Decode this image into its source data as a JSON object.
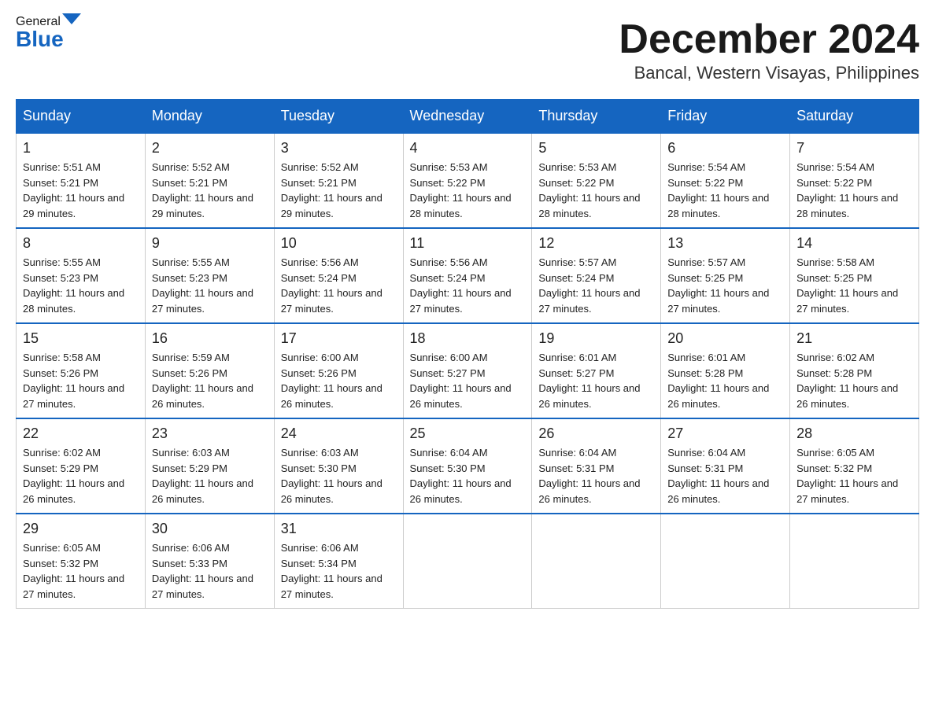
{
  "header": {
    "logo_general": "General",
    "logo_blue": "Blue",
    "month_title": "December 2024",
    "location": "Bancal, Western Visayas, Philippines"
  },
  "days_of_week": [
    "Sunday",
    "Monday",
    "Tuesday",
    "Wednesday",
    "Thursday",
    "Friday",
    "Saturday"
  ],
  "weeks": [
    [
      {
        "day": "1",
        "sunrise": "5:51 AM",
        "sunset": "5:21 PM",
        "daylight": "11 hours and 29 minutes."
      },
      {
        "day": "2",
        "sunrise": "5:52 AM",
        "sunset": "5:21 PM",
        "daylight": "11 hours and 29 minutes."
      },
      {
        "day": "3",
        "sunrise": "5:52 AM",
        "sunset": "5:21 PM",
        "daylight": "11 hours and 29 minutes."
      },
      {
        "day": "4",
        "sunrise": "5:53 AM",
        "sunset": "5:22 PM",
        "daylight": "11 hours and 28 minutes."
      },
      {
        "day": "5",
        "sunrise": "5:53 AM",
        "sunset": "5:22 PM",
        "daylight": "11 hours and 28 minutes."
      },
      {
        "day": "6",
        "sunrise": "5:54 AM",
        "sunset": "5:22 PM",
        "daylight": "11 hours and 28 minutes."
      },
      {
        "day": "7",
        "sunrise": "5:54 AM",
        "sunset": "5:22 PM",
        "daylight": "11 hours and 28 minutes."
      }
    ],
    [
      {
        "day": "8",
        "sunrise": "5:55 AM",
        "sunset": "5:23 PM",
        "daylight": "11 hours and 28 minutes."
      },
      {
        "day": "9",
        "sunrise": "5:55 AM",
        "sunset": "5:23 PM",
        "daylight": "11 hours and 27 minutes."
      },
      {
        "day": "10",
        "sunrise": "5:56 AM",
        "sunset": "5:24 PM",
        "daylight": "11 hours and 27 minutes."
      },
      {
        "day": "11",
        "sunrise": "5:56 AM",
        "sunset": "5:24 PM",
        "daylight": "11 hours and 27 minutes."
      },
      {
        "day": "12",
        "sunrise": "5:57 AM",
        "sunset": "5:24 PM",
        "daylight": "11 hours and 27 minutes."
      },
      {
        "day": "13",
        "sunrise": "5:57 AM",
        "sunset": "5:25 PM",
        "daylight": "11 hours and 27 minutes."
      },
      {
        "day": "14",
        "sunrise": "5:58 AM",
        "sunset": "5:25 PM",
        "daylight": "11 hours and 27 minutes."
      }
    ],
    [
      {
        "day": "15",
        "sunrise": "5:58 AM",
        "sunset": "5:26 PM",
        "daylight": "11 hours and 27 minutes."
      },
      {
        "day": "16",
        "sunrise": "5:59 AM",
        "sunset": "5:26 PM",
        "daylight": "11 hours and 26 minutes."
      },
      {
        "day": "17",
        "sunrise": "6:00 AM",
        "sunset": "5:26 PM",
        "daylight": "11 hours and 26 minutes."
      },
      {
        "day": "18",
        "sunrise": "6:00 AM",
        "sunset": "5:27 PM",
        "daylight": "11 hours and 26 minutes."
      },
      {
        "day": "19",
        "sunrise": "6:01 AM",
        "sunset": "5:27 PM",
        "daylight": "11 hours and 26 minutes."
      },
      {
        "day": "20",
        "sunrise": "6:01 AM",
        "sunset": "5:28 PM",
        "daylight": "11 hours and 26 minutes."
      },
      {
        "day": "21",
        "sunrise": "6:02 AM",
        "sunset": "5:28 PM",
        "daylight": "11 hours and 26 minutes."
      }
    ],
    [
      {
        "day": "22",
        "sunrise": "6:02 AM",
        "sunset": "5:29 PM",
        "daylight": "11 hours and 26 minutes."
      },
      {
        "day": "23",
        "sunrise": "6:03 AM",
        "sunset": "5:29 PM",
        "daylight": "11 hours and 26 minutes."
      },
      {
        "day": "24",
        "sunrise": "6:03 AM",
        "sunset": "5:30 PM",
        "daylight": "11 hours and 26 minutes."
      },
      {
        "day": "25",
        "sunrise": "6:04 AM",
        "sunset": "5:30 PM",
        "daylight": "11 hours and 26 minutes."
      },
      {
        "day": "26",
        "sunrise": "6:04 AM",
        "sunset": "5:31 PM",
        "daylight": "11 hours and 26 minutes."
      },
      {
        "day": "27",
        "sunrise": "6:04 AM",
        "sunset": "5:31 PM",
        "daylight": "11 hours and 26 minutes."
      },
      {
        "day": "28",
        "sunrise": "6:05 AM",
        "sunset": "5:32 PM",
        "daylight": "11 hours and 27 minutes."
      }
    ],
    [
      {
        "day": "29",
        "sunrise": "6:05 AM",
        "sunset": "5:32 PM",
        "daylight": "11 hours and 27 minutes."
      },
      {
        "day": "30",
        "sunrise": "6:06 AM",
        "sunset": "5:33 PM",
        "daylight": "11 hours and 27 minutes."
      },
      {
        "day": "31",
        "sunrise": "6:06 AM",
        "sunset": "5:34 PM",
        "daylight": "11 hours and 27 minutes."
      },
      null,
      null,
      null,
      null
    ]
  ]
}
